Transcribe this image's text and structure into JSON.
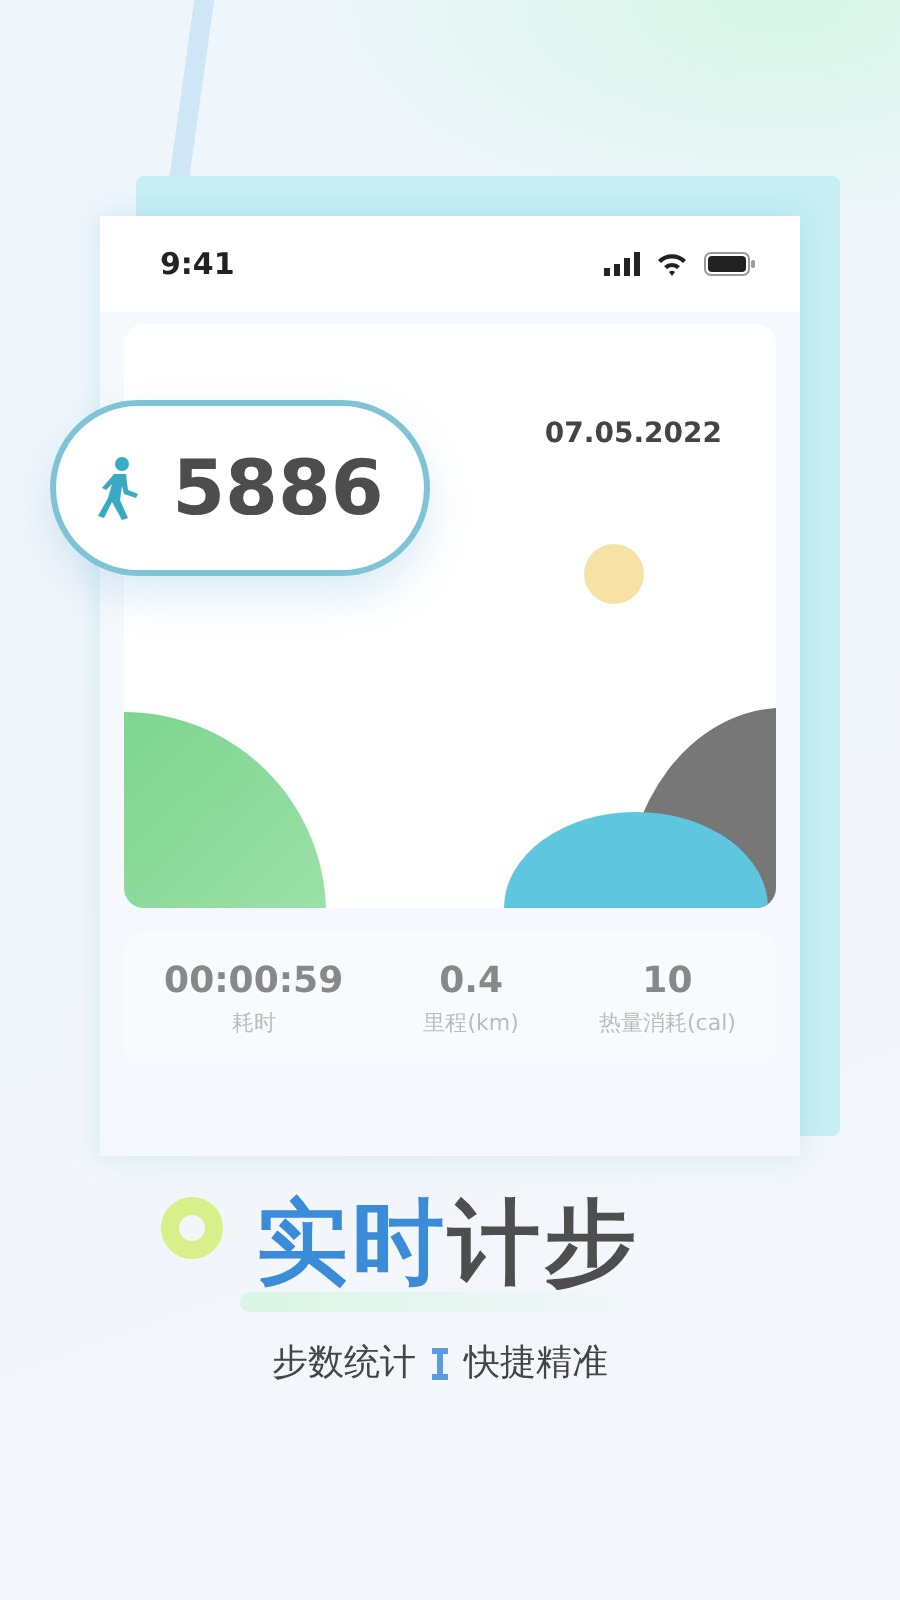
{
  "status_bar": {
    "time": "9:41"
  },
  "step_badge": {
    "count": "5886"
  },
  "date": "07.05.2022",
  "stats": [
    {
      "value": "00:00:59",
      "label": "耗时"
    },
    {
      "value": "0.4",
      "label": "里程(km)"
    },
    {
      "value": "10",
      "label": "热量消耗(cal)"
    }
  ],
  "headline": [
    {
      "text": "实时",
      "kind": "accent"
    },
    {
      "text": "计步",
      "kind": "plain"
    }
  ],
  "subtitle": [
    "步数统计",
    "快捷精准"
  ]
}
